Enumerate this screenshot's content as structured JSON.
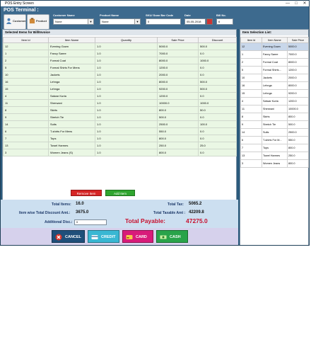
{
  "window": {
    "title": "POS Entry Screen",
    "minimize": "—",
    "maximize": "□",
    "close": "✕"
  },
  "header": {
    "title": "POS Terminal :",
    "customer_button": "Customer",
    "product_button": "Product",
    "customer_name_label": "Customer Name",
    "customer_name_value": "None",
    "product_name_label": "Product Name",
    "product_name_value": "None",
    "sku_label": "SKU/ Scan Bar Code",
    "sku_value": "0",
    "date_label": "Date",
    "date_value": "05-05-2018",
    "bill_no_label": "Bill No.",
    "bill_no_value": "6"
  },
  "selected_items": {
    "title": "Selected Items for Bill/Invoice",
    "columns": [
      "Item Id",
      "Item Name",
      "Quantity",
      "Sale Price",
      "Discount"
    ],
    "rows": [
      [
        "12",
        "Evening Gown",
        "1.0",
        "5000.0",
        "500.0"
      ],
      [
        "1",
        "Fancy Saree",
        "1.0",
        "7000.0",
        "0.0"
      ],
      [
        "2",
        "Formal Coat",
        "1.0",
        "8000.0",
        "1000.0"
      ],
      [
        "5",
        "Formal Shirts For Mens",
        "1.0",
        "1200.0",
        "0.0"
      ],
      [
        "10",
        "Jackets",
        "1.0",
        "2000.0",
        "0.0"
      ],
      [
        "16",
        "Lehnga",
        "1.0",
        "8000.0",
        "500.0"
      ],
      [
        "15",
        "Lehnga",
        "1.0",
        "9200.0",
        "500.0"
      ],
      [
        "4",
        "Salwar Kurta",
        "1.0",
        "1200.0",
        "0.0"
      ],
      [
        "11",
        "Sherwani",
        "1.0",
        "10000.0",
        "1000.0"
      ],
      [
        "8",
        "Skirts",
        "1.0",
        "800.0",
        "50.0"
      ],
      [
        "9",
        "Stretch Tie",
        "1.0",
        "500.0",
        "0.0"
      ],
      [
        "14",
        "Suits",
        "1.0",
        "2500.0",
        "100.0"
      ],
      [
        "6",
        "T-shirts For Mens",
        "1.0",
        "550.0",
        "0.0"
      ],
      [
        "7",
        "Tops",
        "1.0",
        "800.0",
        "0.0"
      ],
      [
        "13",
        "Towel Harmes",
        "1.0",
        "250.0",
        "25.0"
      ],
      [
        "3",
        "Women Jeans (S)",
        "1.0",
        "800.0",
        "0.0"
      ]
    ]
  },
  "buttons": {
    "remove": "Remove Item",
    "add": "Add Item"
  },
  "side": {
    "title": "Item Selection List:",
    "columns": [
      "Item Id",
      "Item Name",
      "Sale Price"
    ],
    "rows": [
      [
        "12",
        "Evening Gown",
        "5000.0"
      ],
      [
        "1",
        "Fancy Saree",
        "7000.0"
      ],
      [
        "2",
        "Formal Coat",
        "8000.0"
      ],
      [
        "5",
        "Formal Shirts...",
        "1200.0"
      ],
      [
        "10",
        "Jackets",
        "2000.0"
      ],
      [
        "16",
        "Lehnga",
        "8000.0"
      ],
      [
        "15",
        "Lehnga",
        "9200.0"
      ],
      [
        "4",
        "Salwar Kurta",
        "1200.0"
      ],
      [
        "11",
        "Sherwani",
        "10000.0"
      ],
      [
        "8",
        "Skirts",
        "800.0"
      ],
      [
        "9",
        "Stretch Tie",
        "500.0"
      ],
      [
        "14",
        "Suits",
        "2500.0"
      ],
      [
        "6",
        "T-shirts For M...",
        "550.0"
      ],
      [
        "7",
        "Tops",
        "800.0"
      ],
      [
        "13",
        "Towel Harmes",
        "250.0"
      ],
      [
        "3",
        "Women Jeans",
        "800.0"
      ]
    ]
  },
  "totals": {
    "total_items_label": "Total Items:",
    "total_items_value": "16.0",
    "item_discount_label": "Item wise Total Discount Amt.:",
    "item_discount_value": "3675.0",
    "additional_disc_label": "Additional Disc.:",
    "additional_disc_value": "0",
    "total_tax_label": "Total Tax:",
    "total_tax_value": "5065.2",
    "total_taxable_label": "Total Taxable Amt :",
    "total_taxable_value": "42209.8",
    "total_payable_label": "Total Payable:",
    "total_payable_value": "47275.0"
  },
  "actions": {
    "cancel": "CANCEL",
    "credit": "CREDIT",
    "card": "CARD",
    "cash": "CASH"
  }
}
